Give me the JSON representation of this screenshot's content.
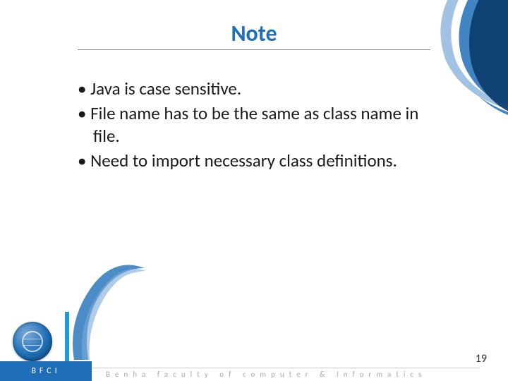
{
  "title": "Note",
  "bullets": [
    "Java is case sensitive.",
    "File name has to be the same as class name in file.",
    "Need to import necessary class definitions."
  ],
  "page_number": "19",
  "footer": {
    "left_label": "BFCI",
    "text": "Benha faculty of computer & Informatics"
  }
}
